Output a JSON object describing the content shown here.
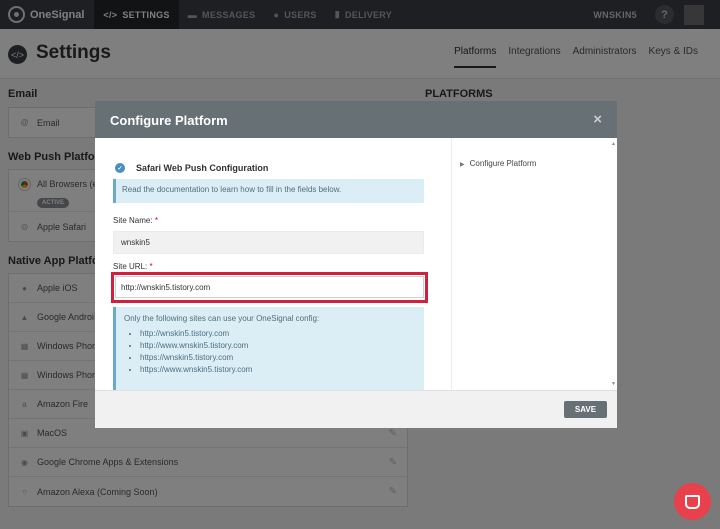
{
  "topnav": {
    "brand": "OneSignal",
    "tabs": [
      {
        "label": "SETTINGS",
        "icon": "code-icon"
      },
      {
        "label": "MESSAGES",
        "icon": "message-icon"
      },
      {
        "label": "USERS",
        "icon": "users-icon"
      },
      {
        "label": "DELIVERY",
        "icon": "bar-chart-icon"
      }
    ],
    "username": "WNSKIN5",
    "help": "?"
  },
  "header": {
    "title": "Settings",
    "subtabs": [
      "Platforms",
      "Integrations",
      "Administrators",
      "Keys & IDs"
    ]
  },
  "sections": {
    "email_heading": "Email",
    "email_item": "Email",
    "webpush_heading": "Web Push Platfo",
    "webpush_items": [
      "All Browsers (e",
      "Apple Safari"
    ],
    "active_badge": "ACTIVE",
    "native_heading": "Native App Platfo",
    "native_items": [
      "Apple iOS",
      "Google Androi",
      "Windows Phon",
      "Windows Phon",
      "Amazon Fire",
      "MacOS",
      "Google Chrome Apps & Extensions",
      "Amazon Alexa (Coming Soon)"
    ],
    "platforms_heading": "PLATFORMS"
  },
  "modal": {
    "title": "Configure Platform",
    "close": "×",
    "config_title": "Safari Web Push Configuration",
    "doc_note_link": "Read the documentation",
    "doc_note_rest": " to learn how to fill in the fields below.",
    "site_name_label": "Site Name:",
    "site_name_value": "wnskin5",
    "site_url_label": "Site URL:",
    "required_mark": "*",
    "site_url_value": "http://wnskin5.tistory.com",
    "sites_intro": "Only the following sites can use your OneSignal config:",
    "sites": [
      "http://wnskin5.tistory.com",
      "http://www.wnskin5.tistory.com",
      "https://wnskin5.tistory.com",
      "https://www.wnskin5.tistory.com"
    ],
    "side_link": "Configure Platform",
    "save_label": "SAVE"
  }
}
